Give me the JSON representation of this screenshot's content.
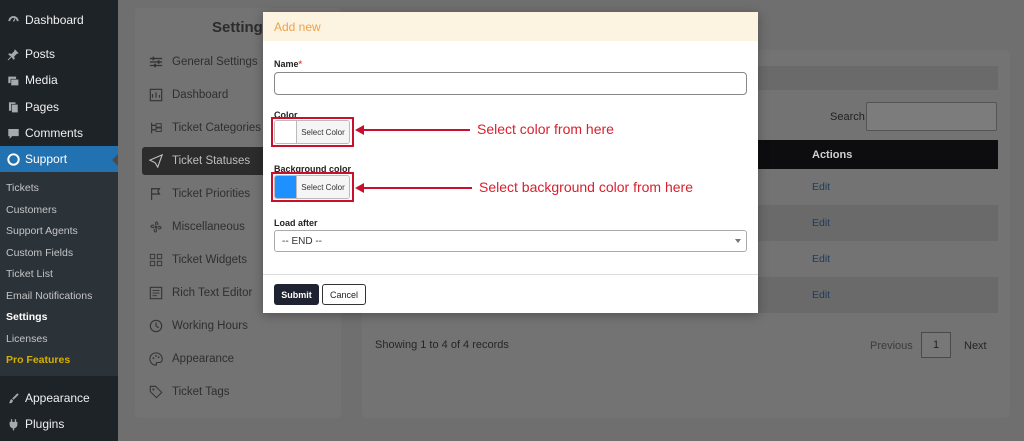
{
  "wp_menu": {
    "dashboard": "Dashboard",
    "posts": "Posts",
    "media": "Media",
    "pages": "Pages",
    "comments": "Comments",
    "support": "Support",
    "appearance": "Appearance",
    "plugins": "Plugins"
  },
  "support_submenu": [
    "Tickets",
    "Customers",
    "Support Agents",
    "Custom Fields",
    "Ticket List",
    "Email Notifications",
    "Settings",
    "Licenses",
    "Pro Features"
  ],
  "settings": {
    "title": "Settings",
    "items": [
      {
        "label": "General Settings",
        "icon": "sliders-icon"
      },
      {
        "label": "Dashboard",
        "icon": "dashboard-icon"
      },
      {
        "label": "Ticket Categories",
        "icon": "categories-icon"
      },
      {
        "label": "Ticket Statuses",
        "icon": "paper-plane-icon"
      },
      {
        "label": "Ticket Priorities",
        "icon": "flag-icon"
      },
      {
        "label": "Miscellaneous",
        "icon": "fan-icon"
      },
      {
        "label": "Ticket Widgets",
        "icon": "widgets-icon"
      },
      {
        "label": "Rich Text Editor",
        "icon": "editor-icon"
      },
      {
        "label": "Working Hours",
        "icon": "clock-icon"
      },
      {
        "label": "Appearance",
        "icon": "palette-icon"
      },
      {
        "label": "Ticket Tags",
        "icon": "tag-icon"
      }
    ]
  },
  "table": {
    "search_label": "Search:",
    "actions_header": "Actions",
    "rows": [
      "Edit",
      "Edit",
      "Edit",
      "Edit"
    ],
    "showing": "Showing 1 to 4 of 4 records",
    "previous": "Previous",
    "page": "1",
    "next": "Next"
  },
  "modal": {
    "title": "Add new",
    "name_label": "Name",
    "required_mark": "*",
    "color_label": "Color",
    "select_color": "Select Color",
    "color_value": "#ffffff",
    "bg_color_label": "Background color",
    "bg_color_value": "#1e90ff",
    "load_after_label": "Load after",
    "load_after_value": "-- END --",
    "submit": "Submit",
    "cancel": "Cancel"
  },
  "annotations": {
    "color_note": "Select color from here",
    "bg_note": "Select background color from here"
  },
  "colors": {
    "annotation": "#d8202e",
    "modal_title": "#f0a04b",
    "wp_active": "#2271b1"
  }
}
